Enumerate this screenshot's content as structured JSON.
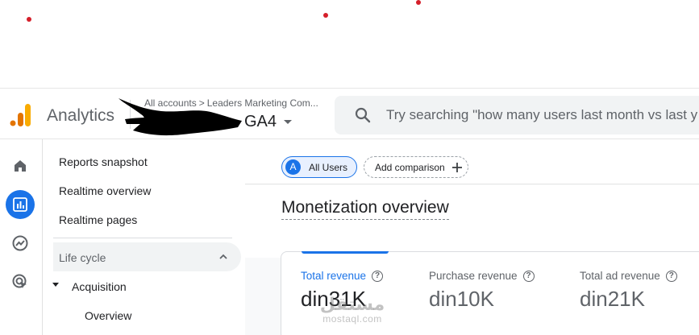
{
  "app": {
    "name": "Analytics"
  },
  "breadcrumb": {
    "root": "All accounts",
    "separator": ">",
    "account": "Leaders Marketing Com..."
  },
  "property": {
    "name": "GA4"
  },
  "search": {
    "placeholder": "Try searching \"how many users last month vs last y"
  },
  "rail": {
    "icons": [
      "home-icon",
      "reports-icon",
      "explore-icon",
      "advertising-icon"
    ]
  },
  "nav": {
    "items": [
      "Reports snapshot",
      "Realtime overview",
      "Realtime pages"
    ],
    "section": "Life cycle",
    "group": "Acquisition",
    "sub_items": [
      "Overview"
    ]
  },
  "comparison": {
    "segment_badge": "A",
    "segment_label": "All Users",
    "add_label": "Add comparison"
  },
  "page": {
    "title": "Monetization overview"
  },
  "metrics": [
    {
      "label": "Total revenue",
      "value": "din31K"
    },
    {
      "label": "Purchase revenue",
      "value": "din10K"
    },
    {
      "label": "Total ad revenue",
      "value": "din21K"
    }
  ],
  "watermark": {
    "ar": "مستقل",
    "en": "mostaql.com"
  },
  "colors": {
    "accent": "#1a73e8",
    "dots": "#d51f2a"
  }
}
